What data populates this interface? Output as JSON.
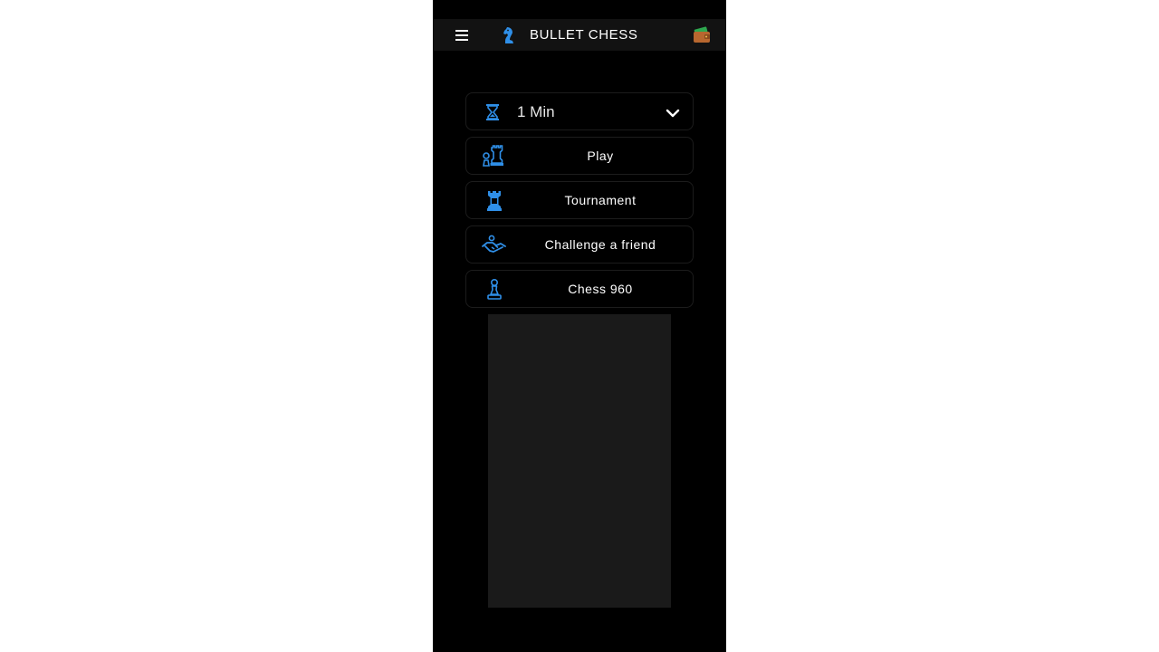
{
  "app_bar": {
    "title": "BULLET CHESS",
    "menu_icon": "hamburger-menu-icon",
    "brand_icon": "knight-icon",
    "wallet_icon": "wallet-icon"
  },
  "time_control": {
    "icon": "hourglass-icon",
    "selected": "1 Min",
    "dropdown_icon": "chevron-down-icon"
  },
  "menu": {
    "items": [
      {
        "label": "Play",
        "icon": "chess-pieces-icon"
      },
      {
        "label": "Tournament",
        "icon": "rook-icon"
      },
      {
        "label": "Challenge a friend",
        "icon": "handshake-icon"
      },
      {
        "label": "Chess 960",
        "icon": "pawn-icon"
      }
    ]
  },
  "colors": {
    "background": "#000000",
    "app_bar": "#121212",
    "accent": "#2f8fe8",
    "card_border": "#1c1c1c",
    "ad_placeholder": "#1a1a1a",
    "text": "#ffffff"
  }
}
